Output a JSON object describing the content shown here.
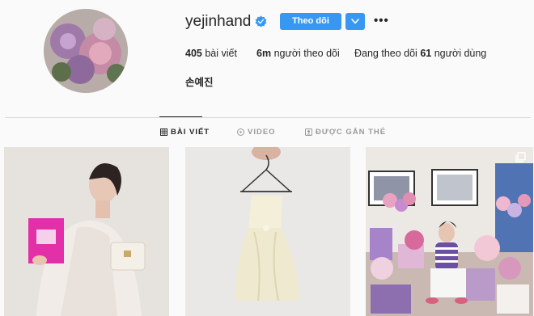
{
  "profile": {
    "username": "yejinhand",
    "verified": true,
    "follow_label": "Theo dõi",
    "more_label": "•••",
    "full_name": "손예진"
  },
  "stats": {
    "posts_count": "405",
    "posts_label": "bài viết",
    "followers_count": "6m",
    "followers_label": "người theo dõi",
    "following_prefix": "Đang theo dõi",
    "following_count": "61",
    "following_suffix": "người dùng"
  },
  "tabs": [
    {
      "label": "BÀI VIẾT",
      "active": true
    },
    {
      "label": "VIDEO",
      "active": false
    },
    {
      "label": "ĐƯỢC GẮN THẺ",
      "active": false
    }
  ],
  "posts": [
    {
      "icon": "photo"
    },
    {
      "icon": "photo"
    },
    {
      "icon": "multiple-photos-icon"
    }
  ],
  "colors": {
    "accent": "#3897f0",
    "background": "#fafafa",
    "text": "#262626",
    "muted": "#999999",
    "divider": "#dbdbdb"
  }
}
